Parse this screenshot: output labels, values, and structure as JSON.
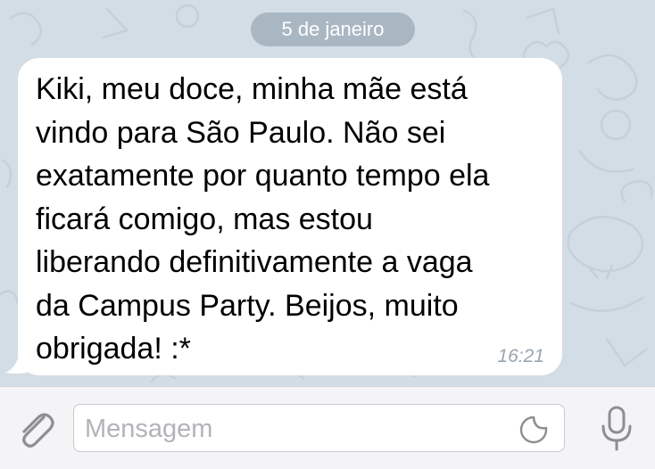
{
  "chat": {
    "date_label": "5 de janeiro",
    "message": {
      "text": "Kiki, meu doce, minha mãe está\nvindo para São Paulo.  Não sei\nexatamente por quanto tempo ela\nficará comigo, mas estou\nliberando definitivamente a vaga\nda Campus Party.  Beijos, muito\nobrigada!  :*",
      "time": "16:21"
    }
  },
  "composer": {
    "placeholder": "Mensagem",
    "icons": {
      "attach": "paperclip-icon",
      "sticker": "sticker-icon",
      "voice": "microphone-icon"
    }
  },
  "colors": {
    "chat_background": "#d3dde5",
    "bubble": "#ffffff",
    "date_pill": "#a9b7c3",
    "input_bar": "#f4f4f6",
    "icon_gray": "#8e8e93"
  }
}
